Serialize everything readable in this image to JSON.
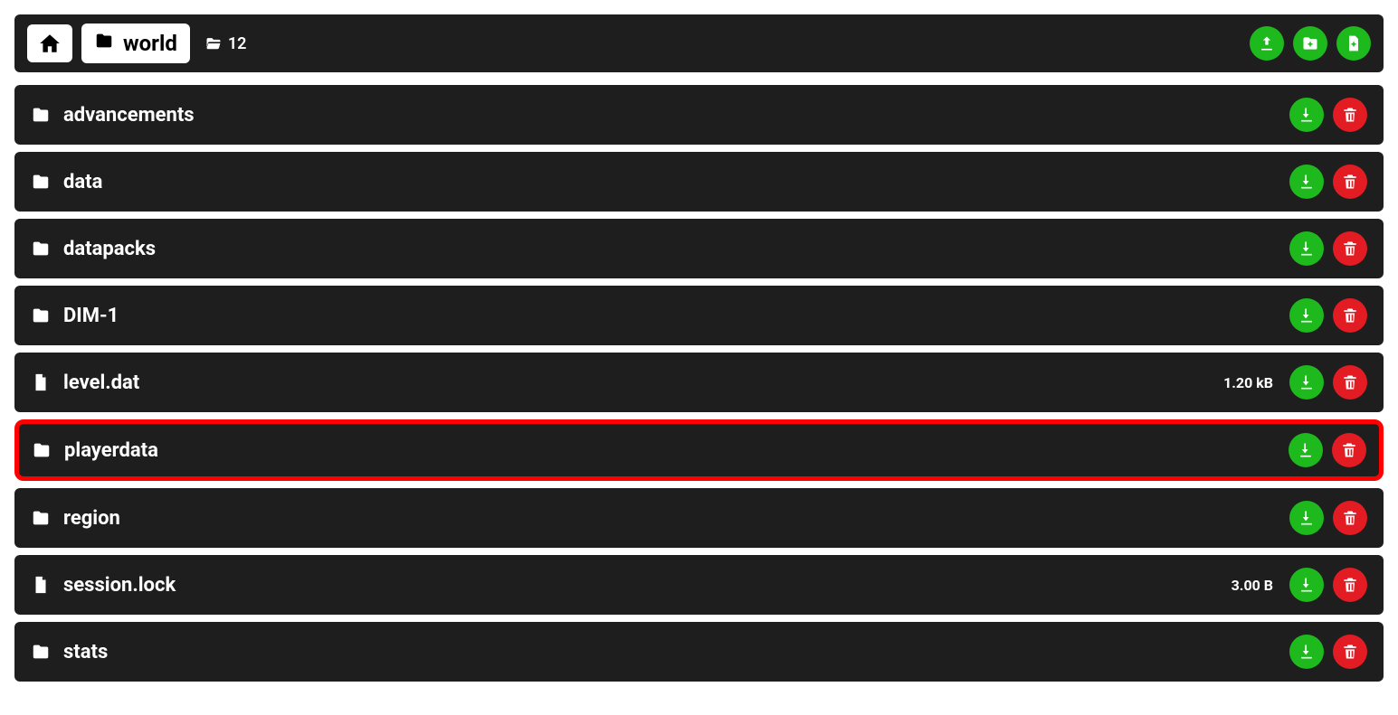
{
  "breadcrumb": {
    "current": "world",
    "count": "12"
  },
  "items": [
    {
      "name": "advancements",
      "type": "folder",
      "size": "",
      "highlight": false
    },
    {
      "name": "data",
      "type": "folder",
      "size": "",
      "highlight": false
    },
    {
      "name": "datapacks",
      "type": "folder",
      "size": "",
      "highlight": false
    },
    {
      "name": "DIM-1",
      "type": "folder",
      "size": "",
      "highlight": false
    },
    {
      "name": "level.dat",
      "type": "file",
      "size": "1.20 kB",
      "highlight": false
    },
    {
      "name": "playerdata",
      "type": "folder",
      "size": "",
      "highlight": true
    },
    {
      "name": "region",
      "type": "folder",
      "size": "",
      "highlight": false
    },
    {
      "name": "session.lock",
      "type": "file",
      "size": "3.00 B",
      "highlight": false
    },
    {
      "name": "stats",
      "type": "folder",
      "size": "",
      "highlight": false
    }
  ]
}
